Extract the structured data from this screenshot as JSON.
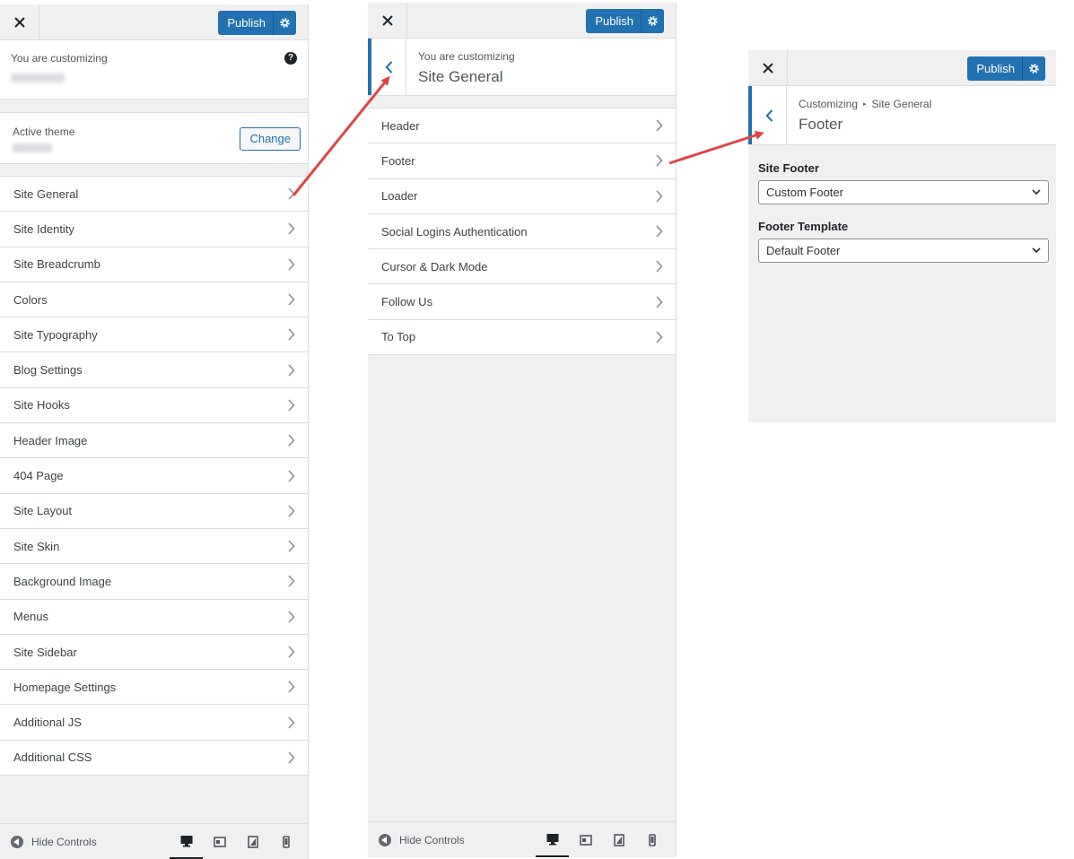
{
  "topbar": {
    "publish_label": "Publish"
  },
  "panel1": {
    "customizing_label": "You are customizing",
    "help_symbol": "?",
    "active_theme_label": "Active theme",
    "change_label": "Change",
    "items": [
      "Site General",
      "Site Identity",
      "Site Breadcrumb",
      "Colors",
      "Site Typography",
      "Blog Settings",
      "Site Hooks",
      "Header Image",
      "404 Page",
      "Site Layout",
      "Site Skin",
      "Background Image",
      "Menus",
      "Site Sidebar",
      "Homepage Settings",
      "Additional JS",
      "Additional CSS"
    ]
  },
  "panel2": {
    "customizing_label": "You are customizing",
    "section_title": "Site General",
    "items": [
      "Header",
      "Footer",
      "Loader",
      "Social Logins Authentication",
      "Cursor & Dark Mode",
      "Follow Us",
      "To Top"
    ]
  },
  "panel3": {
    "breadcrumb_root": "Customizing",
    "breadcrumb_sep": "▸",
    "breadcrumb_parent": "Site General",
    "section_title": "Footer",
    "site_footer_label": "Site Footer",
    "site_footer_value": "Custom Footer",
    "footer_template_label": "Footer Template",
    "footer_template_value": "Default Footer"
  },
  "bottombar": {
    "hide_controls_label": "Hide Controls"
  },
  "colors": {
    "accent": "#2271b1",
    "arrow": "#e04444",
    "panel_bg": "#f0f0f1"
  }
}
